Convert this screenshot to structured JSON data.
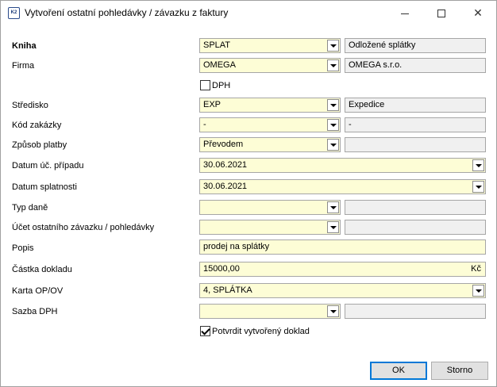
{
  "window": {
    "title": "Vytvoření ostatní pohledávky / závazku z faktury",
    "icon_text": "K2"
  },
  "form": {
    "kniha": {
      "label": "Kniha",
      "value": "SPLAT",
      "desc": "Odložené splátky"
    },
    "firma": {
      "label": "Firma",
      "value": "OMEGA",
      "desc": "OMEGA s.r.o."
    },
    "dph": {
      "label": "DPH",
      "checked": false
    },
    "stredisko": {
      "label": "Středisko",
      "value": "EXP",
      "desc": "Expedice"
    },
    "kod_zakazky": {
      "label": "Kód zakázky",
      "value": "-",
      "desc": "-"
    },
    "zpusob_platby": {
      "label": "Způsob platby",
      "value": "Převodem",
      "desc": ""
    },
    "datum_uc": {
      "label": "Datum úč. případu",
      "value": "30.06.2021"
    },
    "datum_splatnosti": {
      "label": "Datum splatnosti",
      "value": "30.06.2021"
    },
    "typ_dane": {
      "label": "Typ daně",
      "value": "",
      "desc": ""
    },
    "ucet": {
      "label": "Účet ostatního závazku / pohledávky",
      "value": "",
      "desc": ""
    },
    "popis": {
      "label": "Popis",
      "value": "prodej na splátky"
    },
    "castka": {
      "label": "Částka dokladu",
      "value": "15000,00",
      "currency": "Kč"
    },
    "karta": {
      "label": "Karta OP/OV",
      "value": "4, SPLÁTKA"
    },
    "sazba_dph": {
      "label": "Sazba DPH",
      "value": "",
      "desc": ""
    },
    "potvrdit": {
      "label": "Potvrdit vytvořený doklad",
      "checked": true
    }
  },
  "buttons": {
    "ok": "OK",
    "storno": "Storno"
  }
}
